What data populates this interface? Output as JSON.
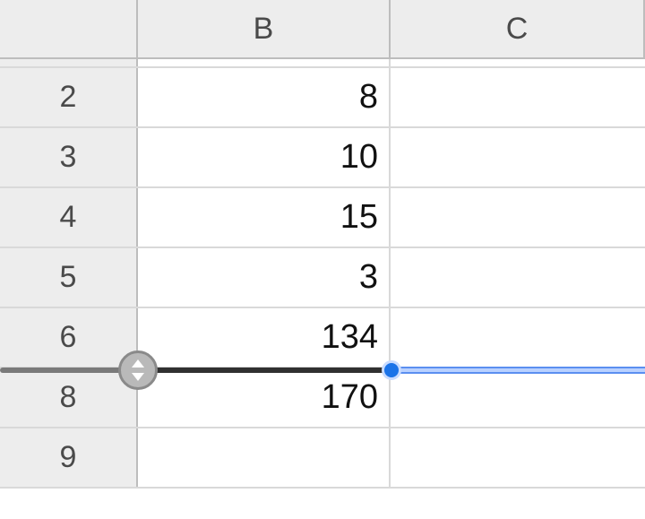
{
  "columns": {
    "B": "B",
    "C": "C"
  },
  "rows": {
    "r2": {
      "num": "2",
      "B": "8",
      "C": ""
    },
    "r3": {
      "num": "3",
      "B": "10",
      "C": ""
    },
    "r4": {
      "num": "4",
      "B": "15",
      "C": ""
    },
    "r5": {
      "num": "5",
      "B": "3",
      "C": ""
    },
    "r6": {
      "num": "6",
      "B": "134",
      "C": ""
    },
    "r8": {
      "num": "8",
      "B": "170",
      "C": ""
    },
    "r9": {
      "num": "9",
      "B": "",
      "C": ""
    }
  }
}
